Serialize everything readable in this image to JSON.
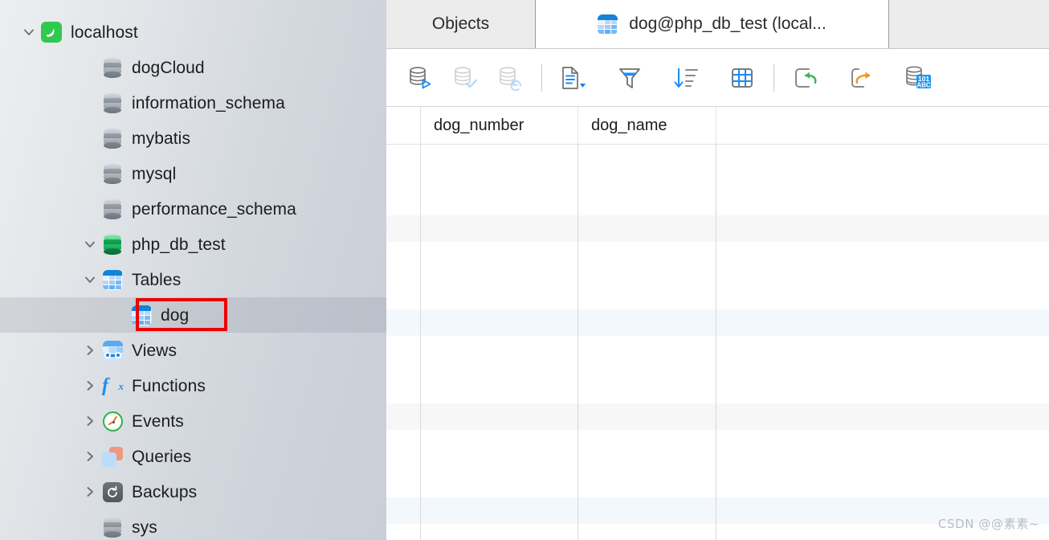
{
  "sidebar": {
    "tree": [
      {
        "label": "localhost",
        "icon": "mysql-dolphin-icon",
        "level": 0,
        "twisty": "expanded",
        "selected": false
      },
      {
        "label": "dogCloud",
        "icon": "database-icon",
        "level": 1,
        "twisty": "none",
        "selected": false
      },
      {
        "label": "information_schema",
        "icon": "database-icon",
        "level": 1,
        "twisty": "none",
        "selected": false
      },
      {
        "label": "mybatis",
        "icon": "database-icon",
        "level": 1,
        "twisty": "none",
        "selected": false
      },
      {
        "label": "mysql",
        "icon": "database-icon",
        "level": 1,
        "twisty": "none",
        "selected": false
      },
      {
        "label": "performance_schema",
        "icon": "database-icon",
        "level": 1,
        "twisty": "none",
        "selected": false
      },
      {
        "label": "php_db_test",
        "icon": "database-open-icon",
        "level": 1,
        "twisty": "expanded",
        "selected": false
      },
      {
        "label": "Tables",
        "icon": "tables-icon",
        "level": 2,
        "twisty": "expanded",
        "selected": false
      },
      {
        "label": "dog",
        "icon": "table-icon",
        "level": 3,
        "twisty": "none",
        "selected": true
      },
      {
        "label": "Views",
        "icon": "views-icon",
        "level": 2,
        "twisty": "collapsed",
        "selected": false
      },
      {
        "label": "Functions",
        "icon": "functions-fx-icon",
        "level": 2,
        "twisty": "collapsed",
        "selected": false
      },
      {
        "label": "Events",
        "icon": "events-clock-icon",
        "level": 2,
        "twisty": "collapsed",
        "selected": false
      },
      {
        "label": "Queries",
        "icon": "queries-icon",
        "level": 2,
        "twisty": "collapsed",
        "selected": false
      },
      {
        "label": "Backups",
        "icon": "backups-icon",
        "level": 2,
        "twisty": "collapsed",
        "selected": false
      },
      {
        "label": "sys",
        "icon": "database-icon",
        "level": 1,
        "twisty": "none",
        "selected": false
      }
    ],
    "highlight_target": "dog"
  },
  "tabs": [
    {
      "label": "Objects",
      "icon": null,
      "active": false
    },
    {
      "label": "dog@php_db_test (local...",
      "icon": "table-icon",
      "active": true
    }
  ],
  "toolbar": {
    "buttons": [
      {
        "name": "begin-transaction-button",
        "title": "Begin Transaction",
        "icon": "database-play-icon",
        "disabled": false
      },
      {
        "name": "commit-button",
        "title": "Commit",
        "icon": "database-check-icon",
        "disabled": true
      },
      {
        "name": "rollback-button",
        "title": "Rollback",
        "icon": "database-undo-icon",
        "disabled": true
      },
      {
        "name": "form-view-button",
        "title": "Form View",
        "icon": "document-dropdown-icon",
        "disabled": false
      },
      {
        "name": "filter-button",
        "title": "Filter",
        "icon": "funnel-icon",
        "disabled": false
      },
      {
        "name": "sort-button",
        "title": "Sort",
        "icon": "sort-descending-icon",
        "disabled": false
      },
      {
        "name": "grid-view-button",
        "title": "Grid View",
        "icon": "grid-table-icon",
        "disabled": false
      },
      {
        "name": "import-wizard-button",
        "title": "Import Wizard",
        "icon": "import-arrow-icon",
        "disabled": false
      },
      {
        "name": "export-wizard-button",
        "title": "Export Wizard",
        "icon": "export-arrow-icon",
        "disabled": false
      },
      {
        "name": "data-charset-button",
        "title": "Data",
        "icon": "database-101abc-icon",
        "disabled": false
      }
    ]
  },
  "grid": {
    "columns": [
      "dog_number",
      "dog_name"
    ],
    "rows": [],
    "row_count": 0
  },
  "watermark": {
    "text": "CSDN @@素素~"
  },
  "colors": {
    "accent_blue": "#1283d8",
    "highlight_red": "#ec0000",
    "selection_gray": "#cdd2d9",
    "band_gray": "#f7f7f8",
    "band_blue": "#f3f8fd",
    "green_db": "#16a85a"
  }
}
